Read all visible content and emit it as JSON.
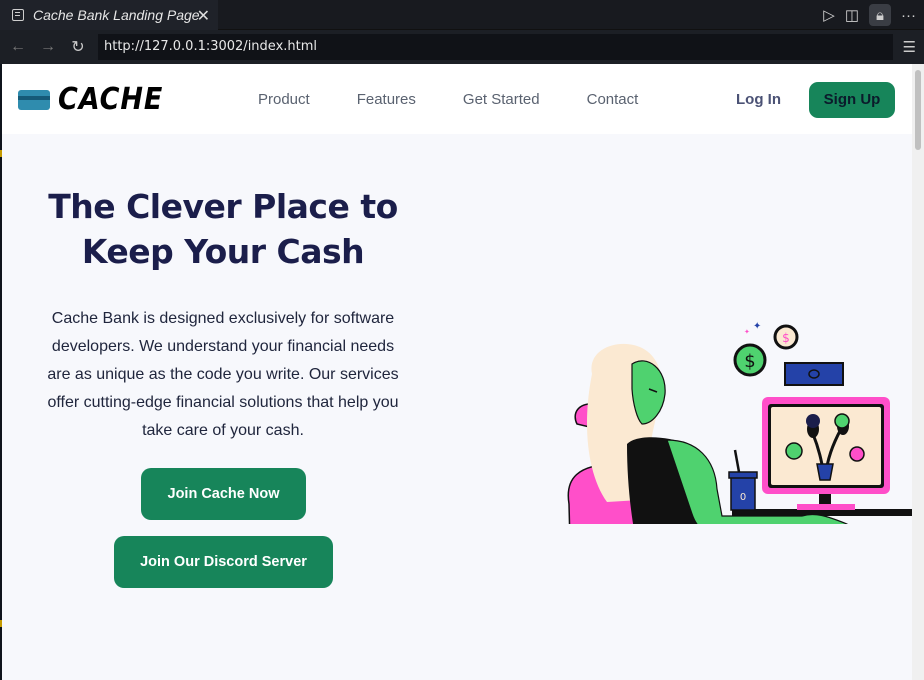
{
  "browser": {
    "tab_title": "Cache Bank Landing Page",
    "url": "http://127.0.0.1:3002/index.html",
    "icons": [
      "page-icon",
      "close-icon",
      "back-icon",
      "forward-icon",
      "reload-icon",
      "play-icon",
      "split-icon",
      "lock-icon",
      "more-icon",
      "menu-icon"
    ]
  },
  "header": {
    "logo_text": "CACHE",
    "nav": [
      "Product",
      "Features",
      "Get Started",
      "Contact"
    ],
    "login_label": "Log In",
    "signup_label": "Sign Up"
  },
  "hero": {
    "title": "The Clever Place to Keep Your Cash",
    "description": "Cache Bank is designed exclusively for software developers. We understand your financial needs are as unique as the code you write. Our services offer cutting-edge financial solutions that help you take care of your cash.",
    "join_label": "Join Cache Now",
    "discord_label": "Join Our Discord Server"
  },
  "colors": {
    "brand_green": "#17855a",
    "heading_navy": "#1b1e4b",
    "illustration_pink": "#ff4fc9",
    "illustration_green": "#4fd26f"
  }
}
